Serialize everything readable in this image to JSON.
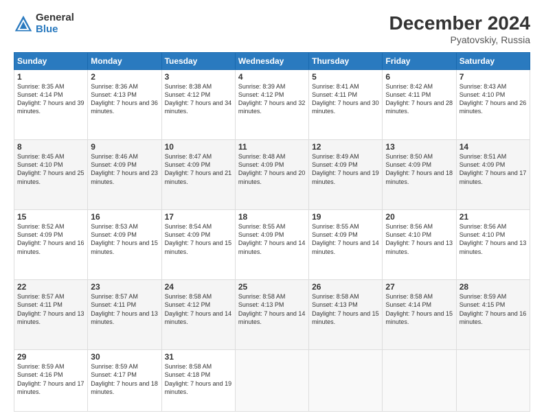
{
  "header": {
    "logo_general": "General",
    "logo_blue": "Blue",
    "month_title": "December 2024",
    "location": "Pyatovskiy, Russia"
  },
  "days_of_week": [
    "Sunday",
    "Monday",
    "Tuesday",
    "Wednesday",
    "Thursday",
    "Friday",
    "Saturday"
  ],
  "weeks": [
    [
      {
        "day": "1",
        "sunrise": "Sunrise: 8:35 AM",
        "sunset": "Sunset: 4:14 PM",
        "daylight": "Daylight: 7 hours and 39 minutes."
      },
      {
        "day": "2",
        "sunrise": "Sunrise: 8:36 AM",
        "sunset": "Sunset: 4:13 PM",
        "daylight": "Daylight: 7 hours and 36 minutes."
      },
      {
        "day": "3",
        "sunrise": "Sunrise: 8:38 AM",
        "sunset": "Sunset: 4:12 PM",
        "daylight": "Daylight: 7 hours and 34 minutes."
      },
      {
        "day": "4",
        "sunrise": "Sunrise: 8:39 AM",
        "sunset": "Sunset: 4:12 PM",
        "daylight": "Daylight: 7 hours and 32 minutes."
      },
      {
        "day": "5",
        "sunrise": "Sunrise: 8:41 AM",
        "sunset": "Sunset: 4:11 PM",
        "daylight": "Daylight: 7 hours and 30 minutes."
      },
      {
        "day": "6",
        "sunrise": "Sunrise: 8:42 AM",
        "sunset": "Sunset: 4:11 PM",
        "daylight": "Daylight: 7 hours and 28 minutes."
      },
      {
        "day": "7",
        "sunrise": "Sunrise: 8:43 AM",
        "sunset": "Sunset: 4:10 PM",
        "daylight": "Daylight: 7 hours and 26 minutes."
      }
    ],
    [
      {
        "day": "8",
        "sunrise": "Sunrise: 8:45 AM",
        "sunset": "Sunset: 4:10 PM",
        "daylight": "Daylight: 7 hours and 25 minutes."
      },
      {
        "day": "9",
        "sunrise": "Sunrise: 8:46 AM",
        "sunset": "Sunset: 4:09 PM",
        "daylight": "Daylight: 7 hours and 23 minutes."
      },
      {
        "day": "10",
        "sunrise": "Sunrise: 8:47 AM",
        "sunset": "Sunset: 4:09 PM",
        "daylight": "Daylight: 7 hours and 21 minutes."
      },
      {
        "day": "11",
        "sunrise": "Sunrise: 8:48 AM",
        "sunset": "Sunset: 4:09 PM",
        "daylight": "Daylight: 7 hours and 20 minutes."
      },
      {
        "day": "12",
        "sunrise": "Sunrise: 8:49 AM",
        "sunset": "Sunset: 4:09 PM",
        "daylight": "Daylight: 7 hours and 19 minutes."
      },
      {
        "day": "13",
        "sunrise": "Sunrise: 8:50 AM",
        "sunset": "Sunset: 4:09 PM",
        "daylight": "Daylight: 7 hours and 18 minutes."
      },
      {
        "day": "14",
        "sunrise": "Sunrise: 8:51 AM",
        "sunset": "Sunset: 4:09 PM",
        "daylight": "Daylight: 7 hours and 17 minutes."
      }
    ],
    [
      {
        "day": "15",
        "sunrise": "Sunrise: 8:52 AM",
        "sunset": "Sunset: 4:09 PM",
        "daylight": "Daylight: 7 hours and 16 minutes."
      },
      {
        "day": "16",
        "sunrise": "Sunrise: 8:53 AM",
        "sunset": "Sunset: 4:09 PM",
        "daylight": "Daylight: 7 hours and 15 minutes."
      },
      {
        "day": "17",
        "sunrise": "Sunrise: 8:54 AM",
        "sunset": "Sunset: 4:09 PM",
        "daylight": "Daylight: 7 hours and 15 minutes."
      },
      {
        "day": "18",
        "sunrise": "Sunrise: 8:55 AM",
        "sunset": "Sunset: 4:09 PM",
        "daylight": "Daylight: 7 hours and 14 minutes."
      },
      {
        "day": "19",
        "sunrise": "Sunrise: 8:55 AM",
        "sunset": "Sunset: 4:09 PM",
        "daylight": "Daylight: 7 hours and 14 minutes."
      },
      {
        "day": "20",
        "sunrise": "Sunrise: 8:56 AM",
        "sunset": "Sunset: 4:10 PM",
        "daylight": "Daylight: 7 hours and 13 minutes."
      },
      {
        "day": "21",
        "sunrise": "Sunrise: 8:56 AM",
        "sunset": "Sunset: 4:10 PM",
        "daylight": "Daylight: 7 hours and 13 minutes."
      }
    ],
    [
      {
        "day": "22",
        "sunrise": "Sunrise: 8:57 AM",
        "sunset": "Sunset: 4:11 PM",
        "daylight": "Daylight: 7 hours and 13 minutes."
      },
      {
        "day": "23",
        "sunrise": "Sunrise: 8:57 AM",
        "sunset": "Sunset: 4:11 PM",
        "daylight": "Daylight: 7 hours and 13 minutes."
      },
      {
        "day": "24",
        "sunrise": "Sunrise: 8:58 AM",
        "sunset": "Sunset: 4:12 PM",
        "daylight": "Daylight: 7 hours and 14 minutes."
      },
      {
        "day": "25",
        "sunrise": "Sunrise: 8:58 AM",
        "sunset": "Sunset: 4:13 PM",
        "daylight": "Daylight: 7 hours and 14 minutes."
      },
      {
        "day": "26",
        "sunrise": "Sunrise: 8:58 AM",
        "sunset": "Sunset: 4:13 PM",
        "daylight": "Daylight: 7 hours and 15 minutes."
      },
      {
        "day": "27",
        "sunrise": "Sunrise: 8:58 AM",
        "sunset": "Sunset: 4:14 PM",
        "daylight": "Daylight: 7 hours and 15 minutes."
      },
      {
        "day": "28",
        "sunrise": "Sunrise: 8:59 AM",
        "sunset": "Sunset: 4:15 PM",
        "daylight": "Daylight: 7 hours and 16 minutes."
      }
    ],
    [
      {
        "day": "29",
        "sunrise": "Sunrise: 8:59 AM",
        "sunset": "Sunset: 4:16 PM",
        "daylight": "Daylight: 7 hours and 17 minutes."
      },
      {
        "day": "30",
        "sunrise": "Sunrise: 8:59 AM",
        "sunset": "Sunset: 4:17 PM",
        "daylight": "Daylight: 7 hours and 18 minutes."
      },
      {
        "day": "31",
        "sunrise": "Sunrise: 8:58 AM",
        "sunset": "Sunset: 4:18 PM",
        "daylight": "Daylight: 7 hours and 19 minutes."
      },
      {
        "day": "",
        "sunrise": "",
        "sunset": "",
        "daylight": ""
      },
      {
        "day": "",
        "sunrise": "",
        "sunset": "",
        "daylight": ""
      },
      {
        "day": "",
        "sunrise": "",
        "sunset": "",
        "daylight": ""
      },
      {
        "day": "",
        "sunrise": "",
        "sunset": "",
        "daylight": ""
      }
    ]
  ]
}
